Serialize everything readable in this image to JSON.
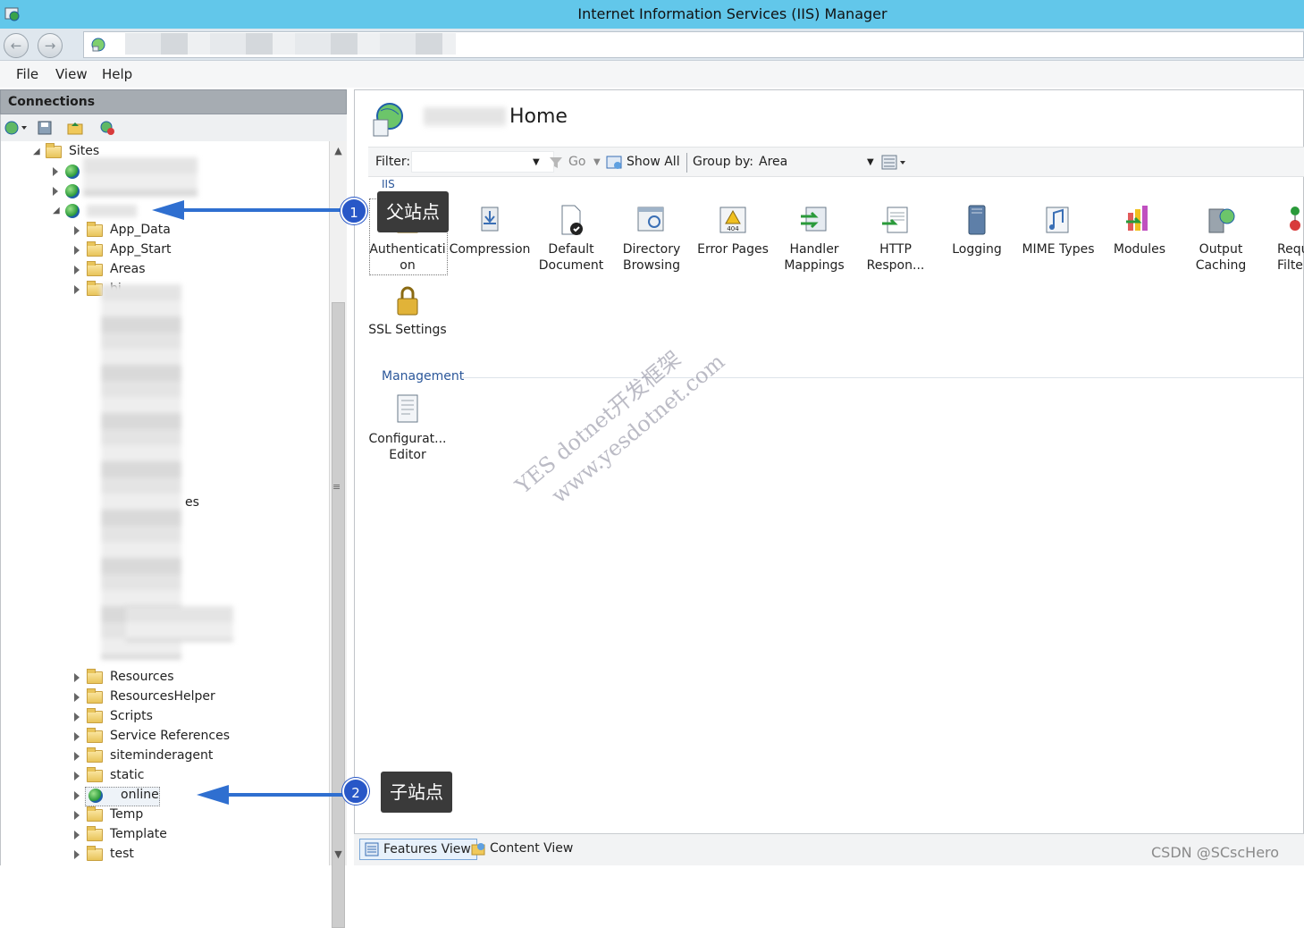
{
  "window": {
    "title": "Internet Information Services (IIS) Manager"
  },
  "menu": {
    "items": [
      "File",
      "View",
      "Help"
    ]
  },
  "connections": {
    "header": "Connections",
    "tree": {
      "root_label": "Sites",
      "folders": [
        "App_Data",
        "App_Start",
        "Areas",
        "bi"
      ],
      "partial_es": "es",
      "folders_bottom": [
        "Resources",
        "ResourcesHelper",
        "Scripts",
        "Service References",
        "siteminderagent",
        "static"
      ],
      "child_site_label": "online",
      "folders_end": [
        "Temp",
        "Template",
        "test"
      ]
    }
  },
  "main": {
    "page_title": "Home",
    "filterbar": {
      "filter_label": "Filter:",
      "go": "Go",
      "show_all": "Show All",
      "group_by": "Group by:",
      "group_value": "Area"
    },
    "group_iis": "IIS",
    "features_iis": [
      {
        "line1": "Authenticati",
        "line2": "on",
        "icon": "lock-user-icon"
      },
      {
        "line1": "Compression",
        "line2": "",
        "icon": "compression-icon"
      },
      {
        "line1": "Default",
        "line2": "Document",
        "icon": "default-document-icon"
      },
      {
        "line1": "Directory",
        "line2": "Browsing",
        "icon": "directory-browsing-icon"
      },
      {
        "line1": "Error Pages",
        "line2": "",
        "icon": "error-pages-icon"
      },
      {
        "line1": "Handler",
        "line2": "Mappings",
        "icon": "handler-mappings-icon"
      },
      {
        "line1": "HTTP",
        "line2": "Respon...",
        "icon": "http-response-icon"
      },
      {
        "line1": "Logging",
        "line2": "",
        "icon": "logging-icon"
      },
      {
        "line1": "MIME Types",
        "line2": "",
        "icon": "mime-types-icon"
      },
      {
        "line1": "Modules",
        "line2": "",
        "icon": "modules-icon"
      },
      {
        "line1": "Output",
        "line2": "Caching",
        "icon": "output-caching-icon"
      },
      {
        "line1": "Requ",
        "line2": "Filte",
        "icon": "request-filtering-icon"
      },
      {
        "line1": "SSL Settings",
        "line2": "",
        "icon": "ssl-lock-icon"
      }
    ],
    "group_management": "Management",
    "features_management": [
      {
        "line1": "Configurat...",
        "line2": "Editor",
        "icon": "configuration-editor-icon"
      }
    ]
  },
  "annotations": {
    "callout1_number": "1",
    "callout1_text": "父站点",
    "callout2_number": "2",
    "callout2_text": "子站点"
  },
  "bottombar": {
    "features_view": "Features View",
    "content_view": "Content View"
  },
  "watermark": {
    "line1": "YES dotnet开发框架",
    "line2": "www.yesdotnet.com"
  },
  "credit": "CSDN @SCscHero"
}
